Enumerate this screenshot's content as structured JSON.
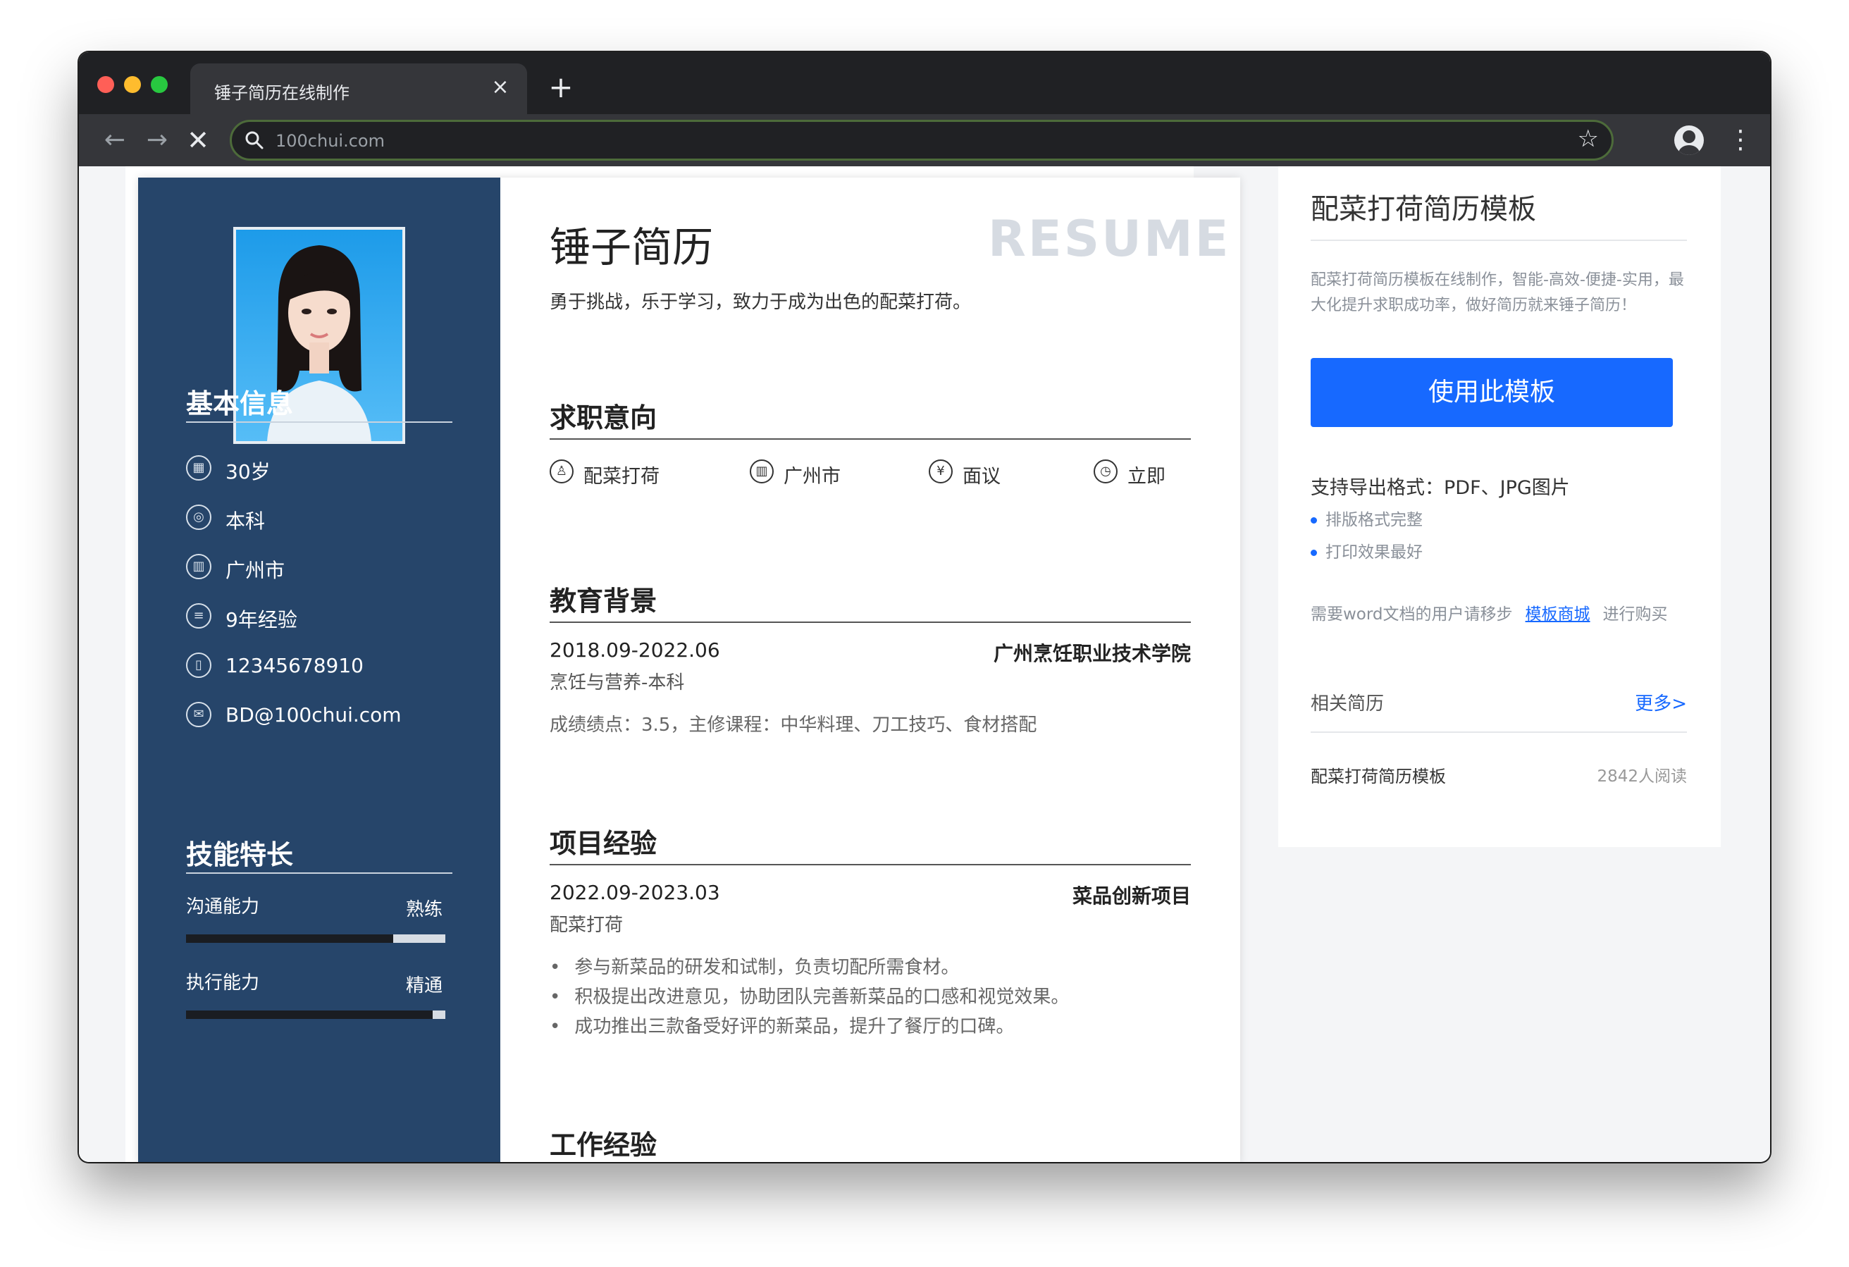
{
  "browser": {
    "tab_title": "锤子简历在线制作",
    "tab_close": "×",
    "new_tab": "+",
    "url": "100chui.com",
    "back": "←",
    "forward": "→",
    "stop": "✕",
    "bookmark": "☆",
    "menu": "⋮"
  },
  "resume": {
    "name": "锤子简历",
    "watermark": "RESUME",
    "motto": "勇于挑战，乐于学习，致力于成为出色的配菜打荷。",
    "basic_info": {
      "title": "基本信息",
      "items": [
        {
          "icon": "calendar-icon",
          "glyph": "▦",
          "text": "30岁"
        },
        {
          "icon": "graduation-icon",
          "glyph": "◎",
          "text": "本科"
        },
        {
          "icon": "building-icon",
          "glyph": "▥",
          "text": "广州市"
        },
        {
          "icon": "document-icon",
          "glyph": "≡",
          "text": "9年经验"
        },
        {
          "icon": "phone-icon",
          "glyph": "▯",
          "text": "12345678910"
        },
        {
          "icon": "mail-icon",
          "glyph": "✉",
          "text": "BD@100chui.com"
        }
      ]
    },
    "skills": {
      "title": "技能特长",
      "items": [
        {
          "name": "沟通能力",
          "level": "熟练",
          "fill": 0.8
        },
        {
          "name": "执行能力",
          "level": "精通",
          "fill": 0.95
        }
      ]
    },
    "job_intent": {
      "title": "求职意向",
      "items": [
        {
          "icon": "chef-hat-icon",
          "glyph": "♙",
          "text": "配菜打荷"
        },
        {
          "icon": "city-icon",
          "glyph": "▥",
          "text": "广州市"
        },
        {
          "icon": "yen-icon",
          "glyph": "¥",
          "text": "面议"
        },
        {
          "icon": "clock-icon",
          "glyph": "◷",
          "text": "立即"
        }
      ]
    },
    "education": {
      "title": "教育背景",
      "date": "2018.09-2022.06",
      "school": "广州烹饪职业技术学院",
      "major": "烹饪与营养-本科",
      "detail": "成绩绩点：3.5，主修课程：中华料理、刀工技巧、食材搭配"
    },
    "projects": {
      "title": "项目经验",
      "date": "2022.09-2023.03",
      "project": "菜品创新项目",
      "role": "配菜打荷",
      "bullets": [
        "参与新菜品的研发和试制，负责切配所需食材。",
        "积极提出改进意见，协助团队完善新菜品的口感和视觉效果。",
        "成功推出三款备受好评的新菜品，提升了餐厅的口碑。"
      ]
    },
    "work": {
      "title": "工作经验"
    }
  },
  "sidebar": {
    "title": "配菜打荷简历模板",
    "desc": "配菜打荷简历模板在线制作，智能-高效-便捷-实用，最大化提升求职成功率，做好简历就来锤子简历！",
    "use_button": "使用此模板",
    "export": "支持导出格式：PDF、JPG图片",
    "points": [
      "排版格式完整",
      "打印效果最好"
    ],
    "word_prefix": "需要word文档的用户请移步",
    "word_link": "模板商城",
    "word_suffix": "进行购买",
    "related_label": "相关简历",
    "more": "更多>",
    "related_items": [
      {
        "title": "配菜打荷简历模板",
        "reads": "2842人阅读"
      }
    ]
  },
  "colors": {
    "left_panel": "#26456a",
    "accent": "#1769ff",
    "browser_frame": "#202124"
  }
}
